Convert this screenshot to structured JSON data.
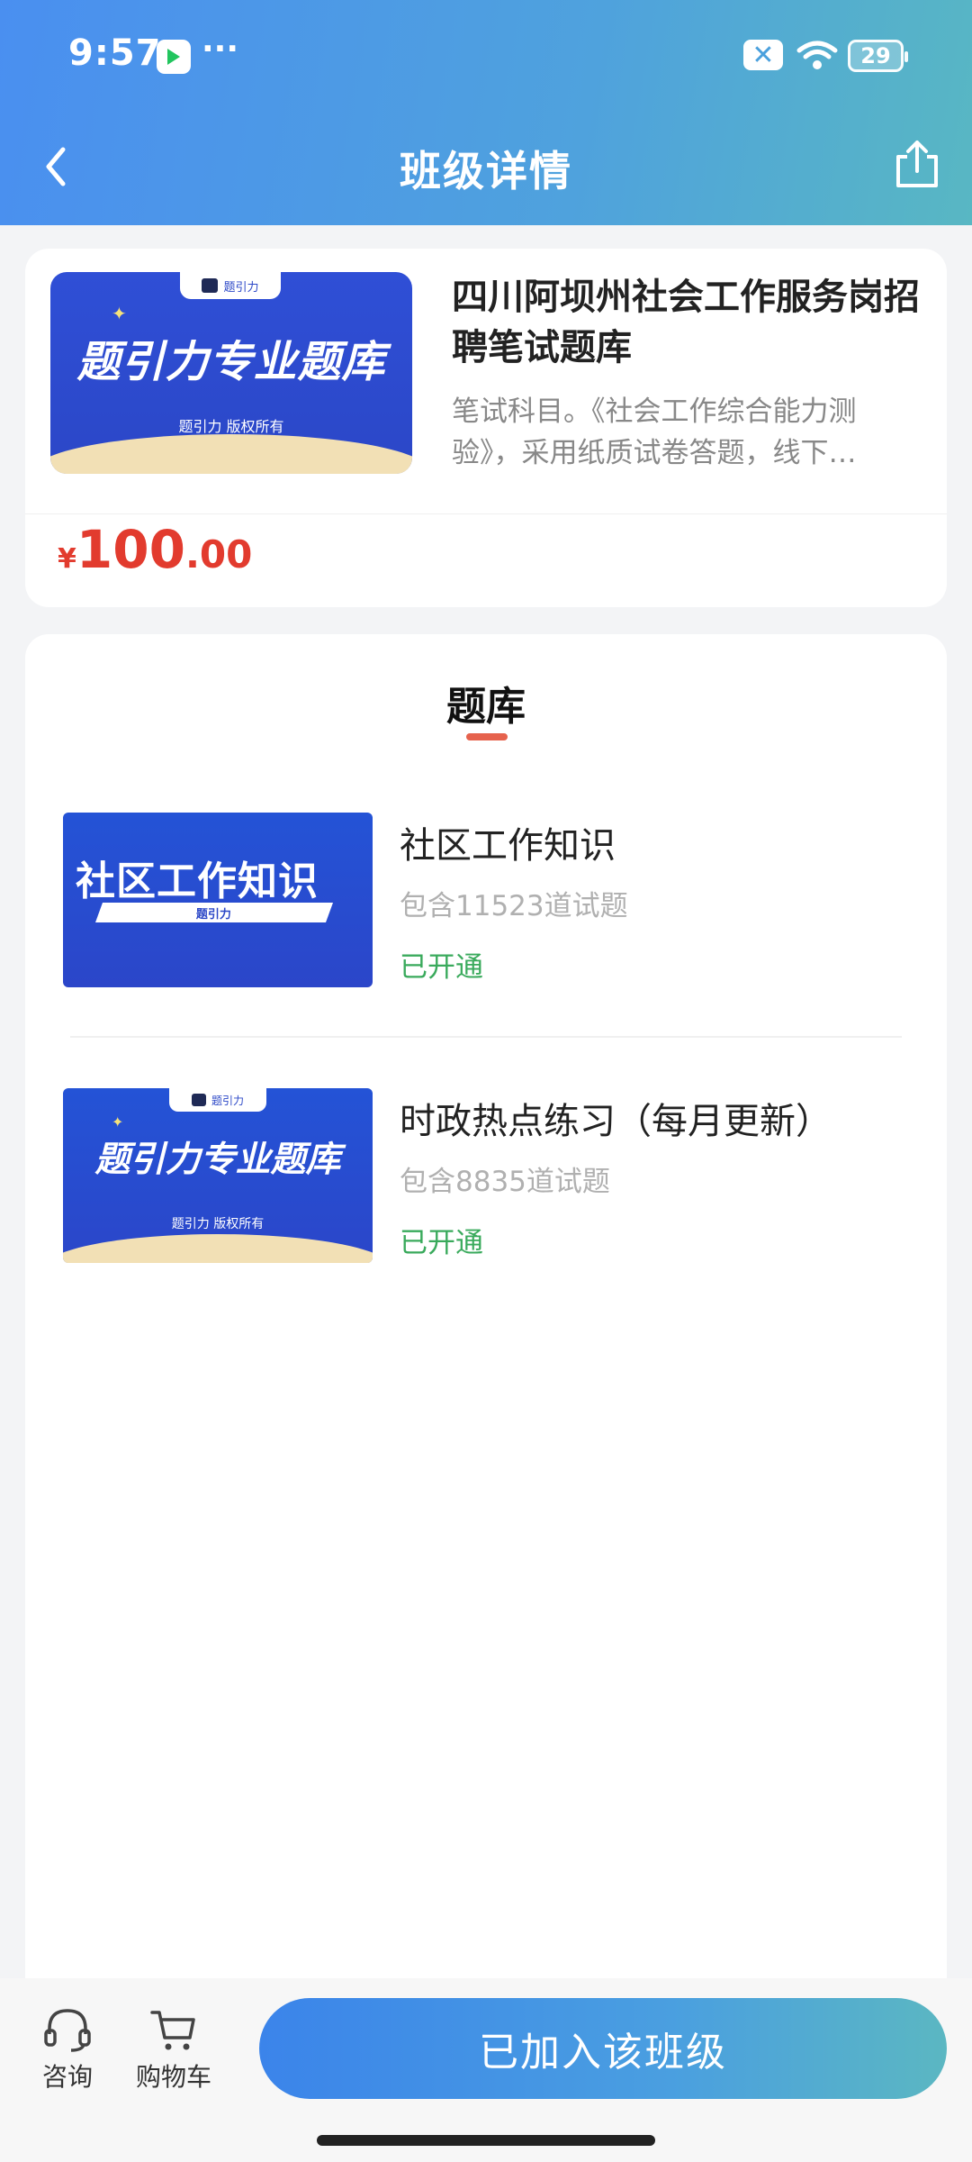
{
  "status_bar": {
    "time": "9:57",
    "dots": "···",
    "notification_x": "✕",
    "battery": "29"
  },
  "header": {
    "title": "班级详情"
  },
  "class_card": {
    "banner": {
      "tab_label": "题引力",
      "headline": "题引力专业题库",
      "copyright": "题引力 版权所有"
    },
    "title": "四川阿坝州社会工作服务岗招聘笔试题库",
    "description": "笔试科目。《社会工作综合能力测验》，采用纸质试卷答题，线下…",
    "price": {
      "currency": "¥",
      "integer": "100",
      "decimal": ".00"
    }
  },
  "question_bank": {
    "section_title": "题库",
    "items": [
      {
        "thumb_text": "社区工作知识",
        "thumb_subtext": "题引力",
        "title": "社区工作知识",
        "count": "包含11523道试题",
        "status": "已开通"
      },
      {
        "thumb_tab": "题引力",
        "thumb_headline": "题引力专业题库",
        "thumb_copyright": "题引力 版权所有",
        "title": "时政热点练习（每月更新）",
        "count": "包含8835道试题",
        "status": "已开通"
      }
    ]
  },
  "bottom_bar": {
    "consult_label": "咨询",
    "cart_label": "购物车",
    "join_button": "已加入该班级"
  },
  "colors": {
    "header_gradient_start": "#4a8ff0",
    "header_gradient_end": "#58b7c3",
    "price": "#e23b2e",
    "status_green": "#3aaa5c",
    "underline": "#e6624d"
  }
}
